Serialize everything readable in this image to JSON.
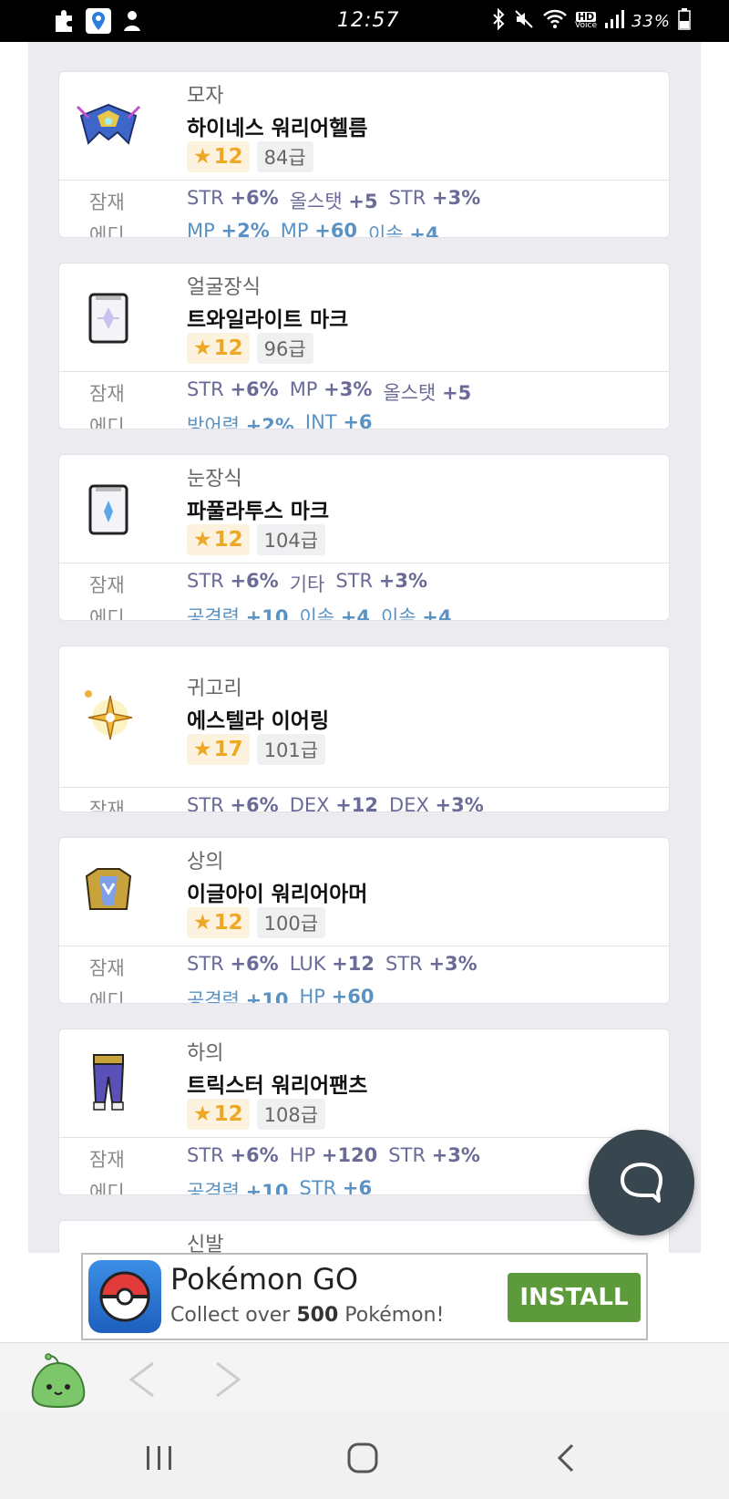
{
  "status_bar": {
    "time": "12:57",
    "battery": "33%",
    "hd_label": "HD",
    "voice_label": "Voice"
  },
  "items": [
    {
      "category": "모자",
      "name": "하이네스 워리어헬름",
      "star": "12",
      "level": "84급",
      "potential_label": "잠재",
      "potential": [
        {
          "stat": "STR",
          "value": "+6%"
        },
        {
          "stat": "올스탯",
          "value": "+5"
        },
        {
          "stat": "STR",
          "value": "+3%"
        }
      ],
      "additional_label": "에디",
      "additional": [
        {
          "stat": "MP",
          "value": "+2%"
        },
        {
          "stat": "MP",
          "value": "+60"
        },
        {
          "stat": "이속",
          "value": "+4"
        }
      ]
    },
    {
      "category": "얼굴장식",
      "name": "트와일라이트 마크",
      "star": "12",
      "level": "96급",
      "potential_label": "잠재",
      "potential": [
        {
          "stat": "STR",
          "value": "+6%"
        },
        {
          "stat": "MP",
          "value": "+3%"
        },
        {
          "stat": "올스탯",
          "value": "+5"
        }
      ],
      "additional_label": "에디",
      "additional": [
        {
          "stat": "방어력",
          "value": "+2%"
        },
        {
          "stat": "INT",
          "value": "+6"
        }
      ]
    },
    {
      "category": "눈장식",
      "name": "파풀라투스 마크",
      "star": "12",
      "level": "104급",
      "potential_label": "잠재",
      "potential": [
        {
          "stat": "STR",
          "value": "+6%"
        },
        {
          "stat": "기타",
          "value": ""
        },
        {
          "stat": "STR",
          "value": "+3%"
        }
      ],
      "additional_label": "에디",
      "additional": [
        {
          "stat": "공격력",
          "value": "+10"
        },
        {
          "stat": "이속",
          "value": "+4"
        },
        {
          "stat": "이속",
          "value": "+4"
        }
      ]
    },
    {
      "category": "귀고리",
      "name": "에스텔라 이어링",
      "star": "17",
      "level": "101급",
      "potential_label": "잠재",
      "potential": [
        {
          "stat": "STR",
          "value": "+6%"
        },
        {
          "stat": "DEX",
          "value": "+12"
        },
        {
          "stat": "DEX",
          "value": "+3%"
        }
      ]
    },
    {
      "category": "상의",
      "name": "이글아이 워리어아머",
      "star": "12",
      "level": "100급",
      "potential_label": "잠재",
      "potential": [
        {
          "stat": "STR",
          "value": "+6%"
        },
        {
          "stat": "LUK",
          "value": "+12"
        },
        {
          "stat": "STR",
          "value": "+3%"
        }
      ],
      "additional_label": "에디",
      "additional": [
        {
          "stat": "공격력",
          "value": "+10"
        },
        {
          "stat": "HP",
          "value": "+60"
        }
      ]
    },
    {
      "category": "하의",
      "name": "트릭스터 워리어팬츠",
      "star": "12",
      "level": "108급",
      "potential_label": "잠재",
      "potential": [
        {
          "stat": "STR",
          "value": "+6%"
        },
        {
          "stat": "HP",
          "value": "+120"
        },
        {
          "stat": "STR",
          "value": "+3%"
        }
      ],
      "additional_label": "에디",
      "additional": [
        {
          "stat": "공격력",
          "value": "+10"
        },
        {
          "stat": "STR",
          "value": "+6"
        }
      ]
    },
    {
      "category": "신발"
    }
  ],
  "ad": {
    "title": "Pokémon GO",
    "subtitle_pre": "Collect over",
    "subtitle_num": "500",
    "subtitle_post": "Pokémon!",
    "install_label": "INSTALL"
  },
  "icons": {
    "chat": "chat-bubble-icon",
    "back": "chevron-left-icon",
    "forward": "chevron-right-icon"
  },
  "colors": {
    "star": "#eda825",
    "potential": "#6b6b98",
    "additional": "#5a92c4",
    "install": "#5d9a3c",
    "fab": "#37464f"
  }
}
